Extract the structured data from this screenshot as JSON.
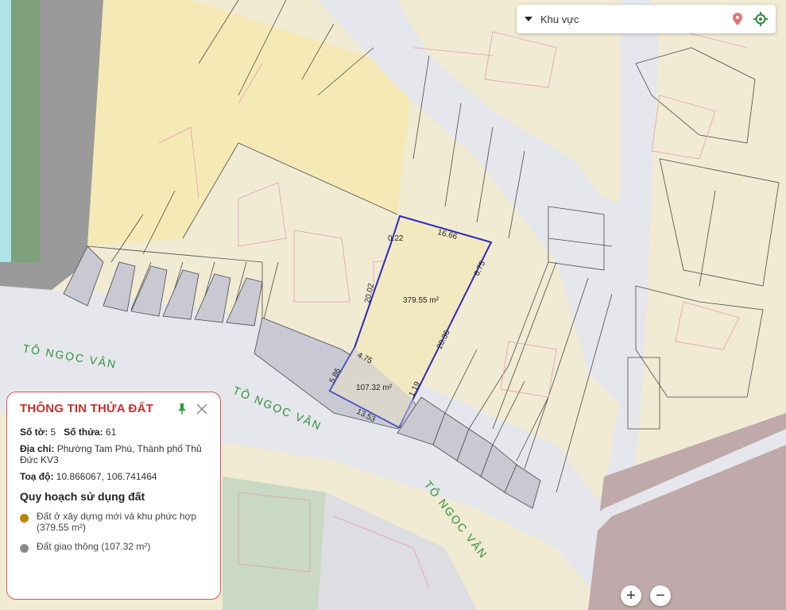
{
  "search": {
    "label": "Khu vực",
    "pin_icon": "map-pin-icon",
    "locate_icon": "locate-target-icon",
    "pin_color": "#e57373",
    "locate_color": "#2e8b3a"
  },
  "map": {
    "road_labels": [
      "TÔ NGỌC VÂN",
      "TÔ NGỌC VÂN",
      "TÔ NGỌC VÂN"
    ],
    "parcel": {
      "area_main": "379.55 m²",
      "area_road": "107.32 m²",
      "edges": [
        "0.22",
        "16.66",
        "6.75",
        "20.36",
        "1.19",
        "13.53",
        "5.86",
        "4.75",
        "20.02"
      ]
    },
    "colors": {
      "parcel_outline": "#2b2bb8",
      "road": "#e6e7ec",
      "lot": "#f1ebd3",
      "highlight_lot": "#f3e9c0",
      "road_lot": "#c9c9d4",
      "pink_lines": "#e59bb3"
    }
  },
  "info": {
    "title": "THÔNG TIN THỬA ĐẤT",
    "so_to_label": "Số tờ:",
    "so_to_value": "5",
    "so_thua_label": "Số thửa:",
    "so_thua_value": "61",
    "dia_chi_label": "Địa chỉ:",
    "dia_chi_value": "Phường Tam Phú, Thành phố Thủ Đức KV3",
    "toa_do_label": "Toạ độ:",
    "toa_do_value": "10.866067, 106.741464",
    "section_title": "Quy hoạch sử dụng đất",
    "legend": [
      {
        "label": "Đất ở xây dựng mới và khu phức hợp (379.55 m²)",
        "color": "#b8860b"
      },
      {
        "label": "Đất giao thông (107.32 m²)",
        "color": "#8a8a8a"
      }
    ]
  },
  "zoom": {
    "in_label": "+",
    "out_label": "−"
  }
}
